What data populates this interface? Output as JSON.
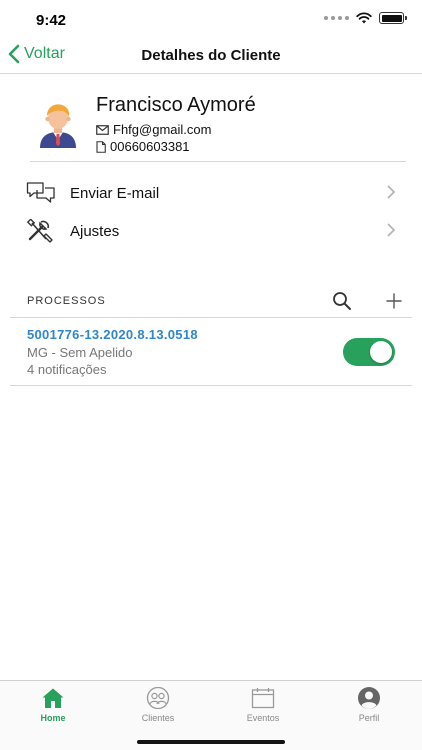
{
  "status_bar": {
    "time": "9:42"
  },
  "nav": {
    "back_label": "Voltar",
    "title": "Detalhes do Cliente"
  },
  "client": {
    "name": "Francisco Aymoré",
    "email": "Fhfg@gmail.com",
    "document": "00660603381"
  },
  "actions": [
    {
      "label": "Enviar E-mail",
      "icon": "chat-bubbles-icon"
    },
    {
      "label": "Ajustes",
      "icon": "tools-icon"
    }
  ],
  "processes": {
    "header": "PROCESSOS",
    "items": [
      {
        "number": "5001776-13.2020.8.13.0518",
        "subtitle": "MG - Sem Apelido",
        "notifications": "4 notificações",
        "enabled": true
      }
    ]
  },
  "tabs": [
    {
      "label": "Home",
      "icon": "home-icon",
      "active": true
    },
    {
      "label": "Clientes",
      "icon": "clients-icon",
      "active": false
    },
    {
      "label": "Eventos",
      "icon": "calendar-icon",
      "active": false
    },
    {
      "label": "Perfil",
      "icon": "profile-icon",
      "active": false
    }
  ],
  "colors": {
    "accent": "#27a15b",
    "link": "#2f86c8"
  }
}
